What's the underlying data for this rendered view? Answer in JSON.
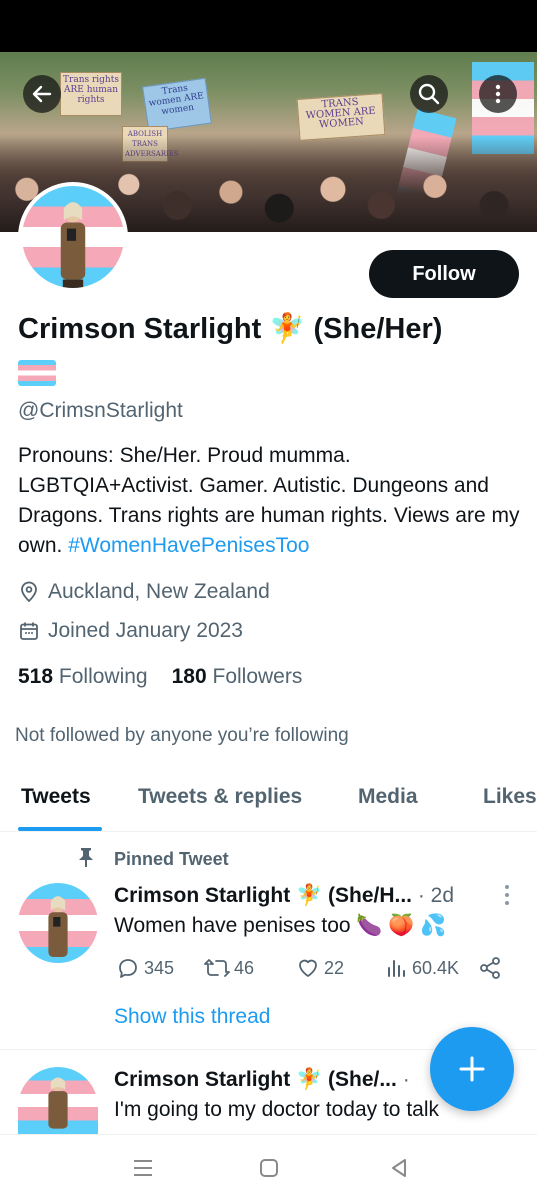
{
  "banner": {
    "signs": [
      "Trans rights ARE human rights",
      "Trans women ARE women",
      "TRANS WOMEN ARE WOMEN",
      "ABOLISH TRANS ADVERSARIES"
    ],
    "icons": {
      "back": "arrow-left-icon",
      "search": "search-icon",
      "more": "more-vertical-icon"
    }
  },
  "profile": {
    "follow_label": "Follow",
    "display_name": "Crimson Starlight 🧚 (She/Her)",
    "flag_emoji": "🏳️‍⚧️",
    "handle": "@CrimsnStarlight",
    "bio_text": "Pronouns: She/Her. Proud mumma. LGBTQIA+Activist. Gamer. Autistic. Dungeons and Dragons. Trans rights are human rights. Views are my own. ",
    "bio_hashtag": "#WomenHavePenisesToo",
    "location": "Auckland, New Zealand",
    "joined": "Joined January 2023",
    "following_count": "518",
    "following_label": "Following",
    "followers_count": "180",
    "followers_label": "Followers",
    "not_followed_text": "Not followed by anyone you’re following"
  },
  "tabs": [
    "Tweets",
    "Tweets & replies",
    "Media",
    "Likes"
  ],
  "active_tab": "Tweets",
  "pinned_tweet": {
    "pinned_label": "Pinned Tweet",
    "author": "Crimson Starlight 🧚 (She/H...",
    "time": "· 2d",
    "text": "Women have penises too 🍆 🍑 💦",
    "replies": "345",
    "retweets": "46",
    "likes": "22",
    "views": "60.4K",
    "show_thread": "Show this thread"
  },
  "second_tweet": {
    "author": "Crimson Starlight 🧚 (She/...",
    "time": "·",
    "text": "I'm going to my doctor today to talk"
  },
  "colors": {
    "accent": "#1d9bf0",
    "text_primary": "#0f1419",
    "text_secondary": "#536471",
    "trans_blue": "#5bcefa",
    "trans_pink": "#f5a9b8"
  },
  "fab_icon": "plus-icon",
  "system_nav": [
    "recents-icon",
    "home-icon",
    "back-icon"
  ]
}
